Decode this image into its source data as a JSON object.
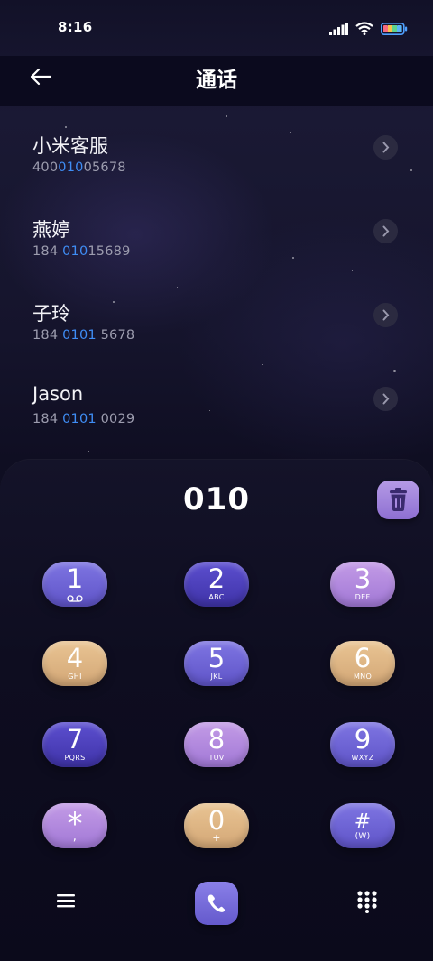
{
  "status_bar": {
    "time": "8:16",
    "icons": [
      "signal-icon",
      "wifi-icon",
      "battery-icon"
    ]
  },
  "header": {
    "title": "通话",
    "back_icon": "arrow-left-icon"
  },
  "results": [
    {
      "name": "小米客服",
      "num_pre": "400",
      "num_match": "010",
      "num_post": "05678"
    },
    {
      "name": "燕婷",
      "num_pre": "184 ",
      "num_match": "010",
      "num_post": "15689"
    },
    {
      "name": "子玲",
      "num_pre": "184 ",
      "num_match": "0101",
      "num_post": " 5678"
    },
    {
      "name": "Jason",
      "num_pre": "184 ",
      "num_match": "0101",
      "num_post": " 0029"
    }
  ],
  "dialpad": {
    "entered": "010",
    "delete_icon": "trash-icon",
    "keys": [
      {
        "digit": "1",
        "letters": "",
        "icon": "voicemail-icon",
        "color": "#6f65d8"
      },
      {
        "digit": "2",
        "letters": "ABC",
        "color": "#4d40bc"
      },
      {
        "digit": "3",
        "letters": "DEF",
        "color": "#b28ade"
      },
      {
        "digit": "4",
        "letters": "GHI",
        "color": "#deb585"
      },
      {
        "digit": "5",
        "letters": "JKL",
        "color": "#6f65d8"
      },
      {
        "digit": "6",
        "letters": "MNO",
        "color": "#deb585"
      },
      {
        "digit": "7",
        "letters": "PQRS",
        "color": "#4d40bc"
      },
      {
        "digit": "8",
        "letters": "TUV",
        "color": "#b28ade"
      },
      {
        "digit": "9",
        "letters": "WXYZ",
        "color": "#6f65d8"
      },
      {
        "digit": "*",
        "letters": ",",
        "color": "#b28ade"
      },
      {
        "digit": "0",
        "letters": "+",
        "color": "#deb585"
      },
      {
        "digit": "#",
        "letters": "(W)",
        "color": "#6f65d8"
      }
    ]
  },
  "bottom_bar": {
    "menu_icon": "menu-icon",
    "call_icon": "phone-icon",
    "keypad_icon": "keypad-icon"
  },
  "accent_color": "#3f8df5"
}
